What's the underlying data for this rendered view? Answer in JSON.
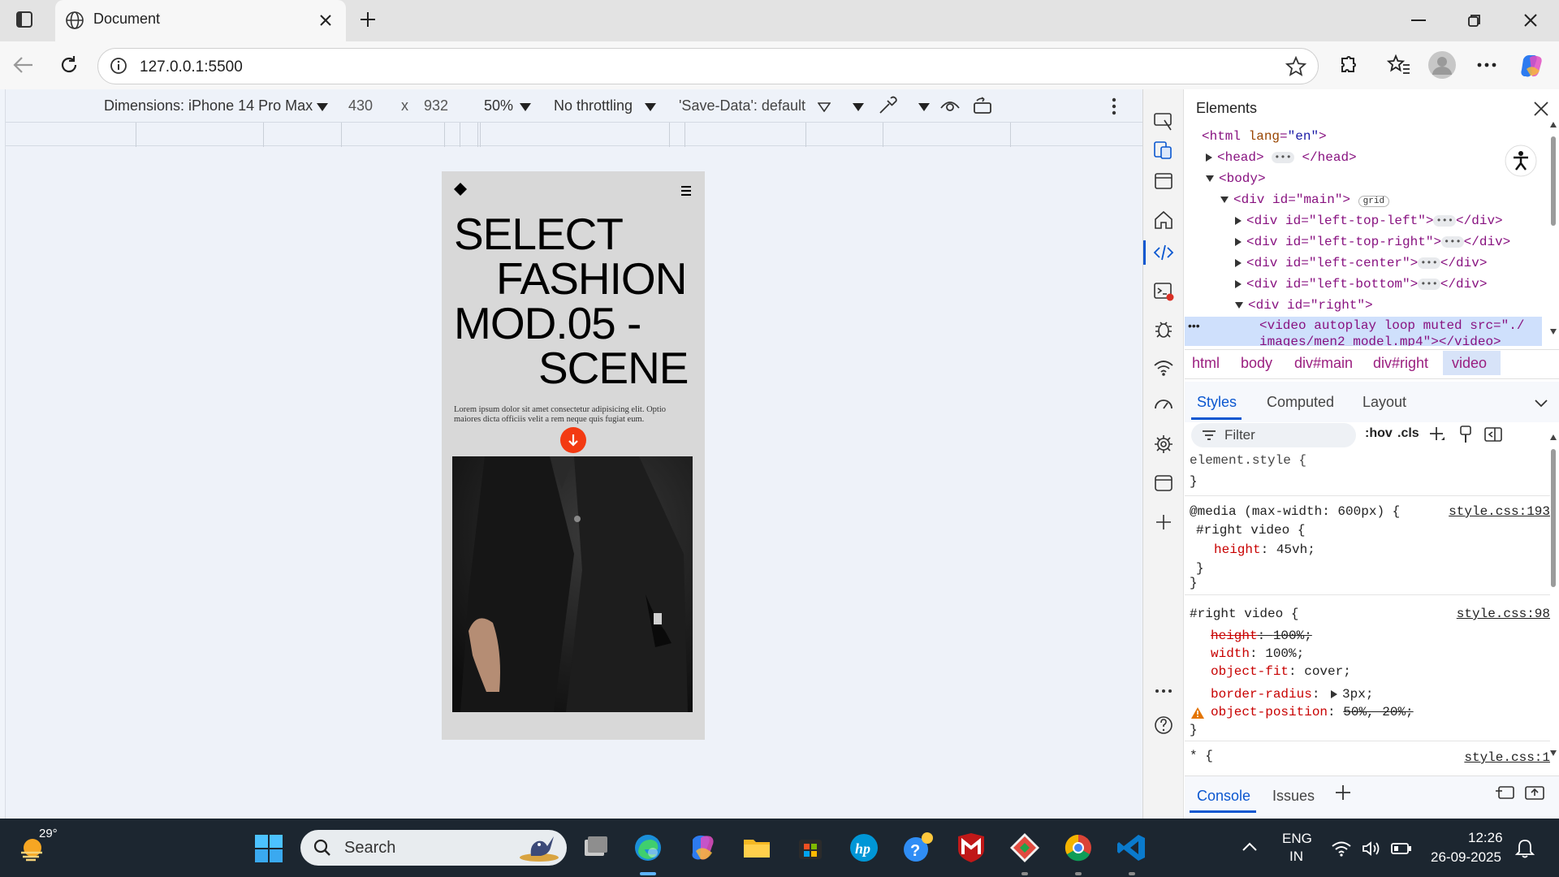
{
  "browser": {
    "tab_title": "Document",
    "url": "127.0.0.1:5500"
  },
  "device_toolbar": {
    "dimensions": "Dimensions: iPhone 14 Pro Max",
    "width": "430",
    "x_sep": "x",
    "height": "932",
    "zoom": "50%",
    "throttling": "No throttling",
    "save_data": "'Save-Data': default"
  },
  "site": {
    "hero_lines": [
      "SELECT",
      "FASHION",
      "MOD.05 -",
      "SCENE"
    ],
    "lorem": "Lorem ipsum dolor sit amet consectetur adipisicing elit. Optio maiores dicta officiis velit a rem neque quis fugiat eum."
  },
  "devtools": {
    "title": "Elements",
    "dom": [
      {
        "open": "<html",
        "attr": " lang",
        "val": "\"en\"",
        "close": ">"
      },
      {
        "text": "<head>",
        "tail": "</head>"
      },
      {
        "text": "<body>"
      },
      {
        "text": "<div id=\"main\">",
        "badge": "grid"
      },
      {
        "text": "<div id=\"left-top-left\">",
        "tail": "</div>"
      },
      {
        "text": "<div id=\"left-top-right\">",
        "tail": "</div>"
      },
      {
        "text": "<div id=\"left-center\">",
        "tail": "</div>"
      },
      {
        "text": "<div id=\"left-bottom\">",
        "tail": "</div>"
      },
      {
        "text": "<div id=\"right\">"
      },
      {
        "text": "<video autoplay loop muted src=\"./",
        "text2": "images/men2_model.mp4\"></video>"
      }
    ],
    "breadcrumbs": [
      "html",
      "body",
      "div#main",
      "div#right",
      "video"
    ],
    "panel_tabs": [
      "Styles",
      "Computed",
      "Layout"
    ],
    "filter_placeholder": "Filter",
    "hov": ":hov",
    "cls": ".cls",
    "styles": {
      "element_style": "element.style {",
      "close": "}",
      "media": "@media (max-width: 600px) {",
      "media_src": "style.css:193",
      "media_selector": "#right video {",
      "media_prop": "height",
      "media_val": "45vh;",
      "rule_selector": "#right video {",
      "rule_src": "style.css:98",
      "p_height": "height",
      "v_height": "100%;",
      "p_width": "width",
      "v_width": "100%;",
      "p_fit": "object-fit",
      "v_fit": "cover;",
      "p_radius": "border-radius",
      "v_radius": "3px;",
      "p_pos": "object-position",
      "v_pos": "50%, 20%;",
      "star_selector": "* {",
      "star_src": "style.css:1"
    },
    "drawer_tabs": [
      "Console",
      "Issues"
    ]
  },
  "taskbar": {
    "weather": "29°",
    "search": "Search",
    "lang1": "ENG",
    "lang2": "IN",
    "time": "12:26",
    "date": "26-09-2025"
  },
  "colors": {
    "accent_orange": "#f33a12",
    "devtools_blue": "#0b57d0",
    "taskbar": "#1c2630"
  }
}
